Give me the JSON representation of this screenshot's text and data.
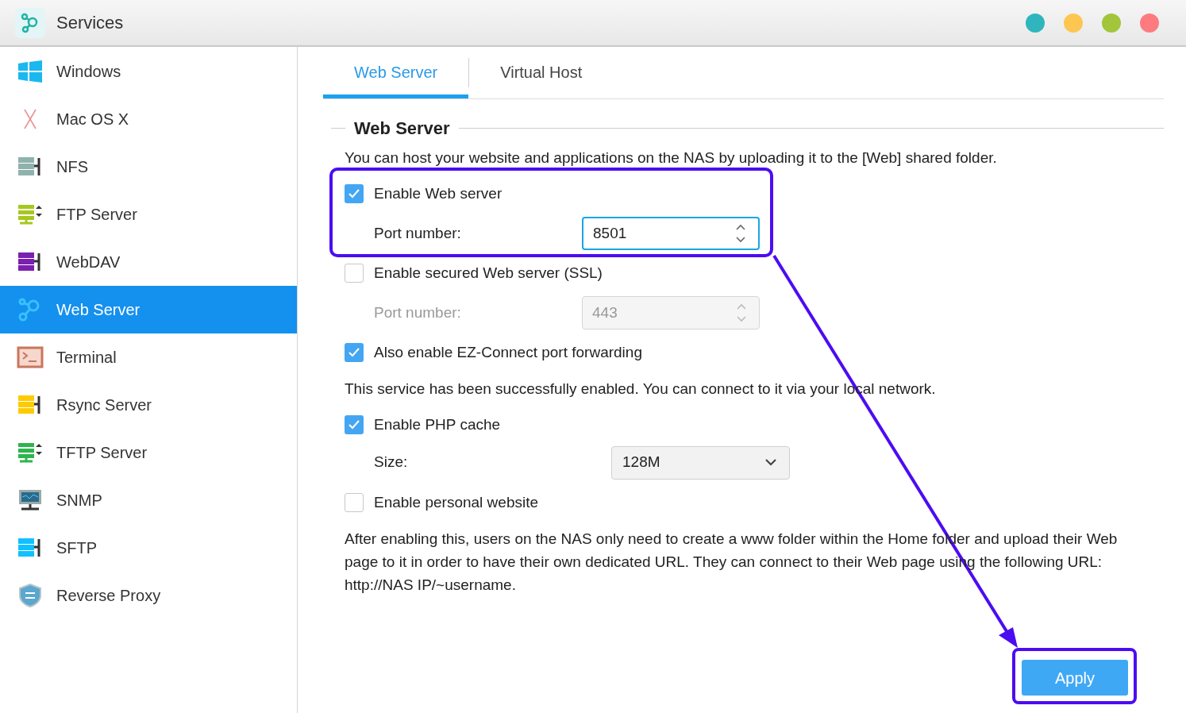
{
  "window": {
    "title": "Services",
    "controls": [
      {
        "color": "#2fb5bd"
      },
      {
        "color": "#fdc651"
      },
      {
        "color": "#a2c53b"
      },
      {
        "color": "#fd7b7f"
      }
    ]
  },
  "sidebar": {
    "items": [
      {
        "label": "Windows",
        "selected": false
      },
      {
        "label": "Mac OS X",
        "selected": false
      },
      {
        "label": "NFS",
        "selected": false
      },
      {
        "label": "FTP Server",
        "selected": false
      },
      {
        "label": "WebDAV",
        "selected": false
      },
      {
        "label": "Web Server",
        "selected": true
      },
      {
        "label": "Terminal",
        "selected": false
      },
      {
        "label": "Rsync Server",
        "selected": false
      },
      {
        "label": "TFTP Server",
        "selected": false
      },
      {
        "label": "SNMP",
        "selected": false
      },
      {
        "label": "SFTP",
        "selected": false
      },
      {
        "label": "Reverse Proxy",
        "selected": false
      }
    ]
  },
  "tabs": [
    {
      "label": "Web Server",
      "selected": true
    },
    {
      "label": "Virtual Host",
      "selected": false
    }
  ],
  "section": {
    "title": "Web Server"
  },
  "rows": [
    {
      "kind": "text",
      "text": "You can host your website and applications on the NAS by uploading it to the [Web] shared folder."
    },
    {
      "kind": "checkbox",
      "label": "Enable Web server",
      "checked": true
    },
    {
      "kind": "spin",
      "label": "Port number:",
      "value": "8501",
      "disabled": false
    },
    {
      "kind": "checkbox",
      "label": "Enable secured Web server (SSL)",
      "checked": false
    },
    {
      "kind": "spin",
      "label": "Port number:",
      "value": "443",
      "disabled": true
    },
    {
      "kind": "checkbox",
      "label": "Also enable EZ-Connect port forwarding",
      "checked": true
    },
    {
      "kind": "text",
      "text": "This service has been successfully enabled. You can connect to it via your local network."
    },
    {
      "kind": "checkbox",
      "label": "Enable PHP cache",
      "checked": true
    },
    {
      "kind": "select",
      "label": "Size:",
      "value": "128M"
    },
    {
      "kind": "checkbox",
      "label": "Enable personal website",
      "checked": false
    },
    {
      "kind": "text",
      "text": "After enabling this, users on the NAS only need to create a www folder within the Home folder and upload their Web page to it in order to have their own dedicated URL. They can connect to their Web page using the following URL: http://NAS IP/~username."
    }
  ],
  "apply_button": "Apply"
}
